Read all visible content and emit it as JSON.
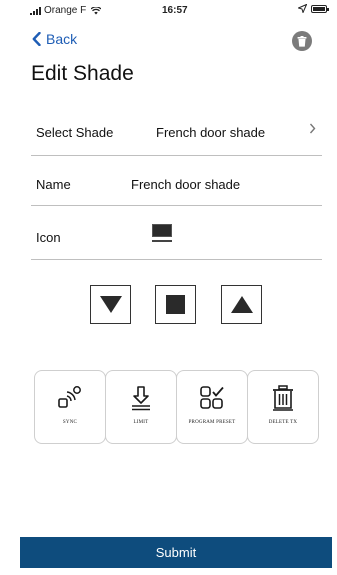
{
  "status_bar": {
    "carrier": "Orange F",
    "time": "16:57"
  },
  "nav": {
    "back_label": "Back",
    "title": "Edit Shade"
  },
  "form": {
    "select_shade": {
      "label": "Select Shade",
      "value": "French door shade"
    },
    "name": {
      "label": "Name",
      "value": "French door shade"
    },
    "icon": {
      "label": "Icon"
    }
  },
  "controls": {
    "down": "arrow-down-icon",
    "stop": "stop-icon",
    "up": "arrow-up-icon"
  },
  "actions": [
    {
      "icon": "sync-icon",
      "label": "SYNC"
    },
    {
      "icon": "limit-icon",
      "label": "LIMIT"
    },
    {
      "icon": "program-preset-icon",
      "label": "PROGRAM PRESET"
    },
    {
      "icon": "delete-tx-icon",
      "label": "DELETE TX"
    }
  ],
  "submit_label": "Submit",
  "colors": {
    "accent": "#1e5db5",
    "submit_bg": "#0e4c7d",
    "divider": "#bfbfbf"
  }
}
